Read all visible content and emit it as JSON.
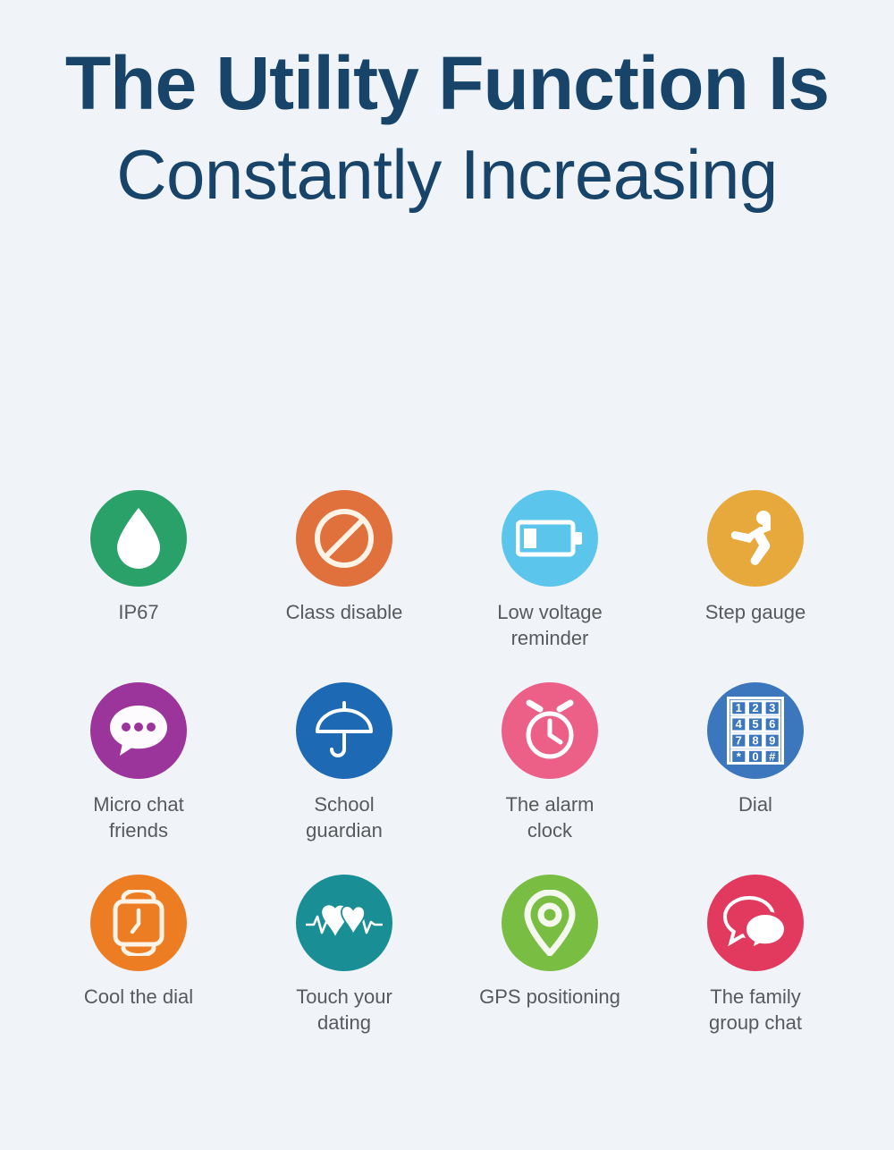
{
  "page": {
    "background_color": "#f0f4f9",
    "heading": {
      "line1": "The Utility Function Is",
      "line2": "Constantly Increasing",
      "color": "#174468"
    },
    "label_color": "#58595b"
  },
  "features": [
    {
      "id": "ip67",
      "label_line1": "IP67",
      "label_line2": "",
      "icon": "water-drop-icon",
      "circle_color": "#2aa169",
      "glyph_color": "#ffffff"
    },
    {
      "id": "class-disable",
      "label_line1": "Class disable",
      "label_line2": "",
      "icon": "prohibition-icon",
      "circle_color": "#e0703c",
      "glyph_color": "#fdf2e6"
    },
    {
      "id": "low-voltage-reminder",
      "label_line1": "Low voltage",
      "label_line2": "reminder",
      "icon": "battery-low-icon",
      "circle_color": "#5bc5ec",
      "glyph_color": "#ffffff"
    },
    {
      "id": "step-gauge",
      "label_line1": "Step gauge",
      "label_line2": "",
      "icon": "running-person-icon",
      "circle_color": "#e8a93c",
      "glyph_color": "#ffffff"
    },
    {
      "id": "micro-chat-friends",
      "label_line1": "Micro chat",
      "label_line2": "friends",
      "icon": "chat-bubble-dots-icon",
      "circle_color": "#9c359b",
      "glyph_color": "#fdfbfd"
    },
    {
      "id": "school-guardian",
      "label_line1": "School",
      "label_line2": "guardian",
      "icon": "umbrella-icon",
      "circle_color": "#1d69b4",
      "glyph_color": "#ffffff"
    },
    {
      "id": "the-alarm-clock",
      "label_line1": "The alarm",
      "label_line2": "clock",
      "icon": "alarm-clock-icon",
      "circle_color": "#ec6088",
      "glyph_color": "#ffffff"
    },
    {
      "id": "dial",
      "label_line1": "Dial",
      "label_line2": "",
      "icon": "dial-keypad-icon",
      "circle_color": "#3c76bd",
      "glyph_color": "#ffffff",
      "keypad_keys": [
        "1",
        "2",
        "3",
        "4",
        "5",
        "6",
        "7",
        "8",
        "9",
        "*",
        "0",
        "#"
      ]
    },
    {
      "id": "cool-the-dial",
      "label_line1": "Cool the dial",
      "label_line2": "",
      "icon": "smartwatch-icon",
      "circle_color": "#ed7d22",
      "glyph_color": "#fdf3e6"
    },
    {
      "id": "touch-your-dating",
      "label_line1": "Touch your",
      "label_line2": "dating",
      "icon": "two-hearts-ecg-icon",
      "circle_color": "#1a8e95",
      "glyph_color": "#ffffff"
    },
    {
      "id": "gps-positioning",
      "label_line1": "GPS positioning",
      "label_line2": "",
      "icon": "map-pin-icon",
      "circle_color": "#79bd42",
      "glyph_color": "#f4f8ef"
    },
    {
      "id": "the-family-group-chat",
      "label_line1": "The family",
      "label_line2": "group chat",
      "icon": "group-chat-bubbles-icon",
      "circle_color": "#e23a5e",
      "glyph_color": "#ffffff"
    }
  ]
}
